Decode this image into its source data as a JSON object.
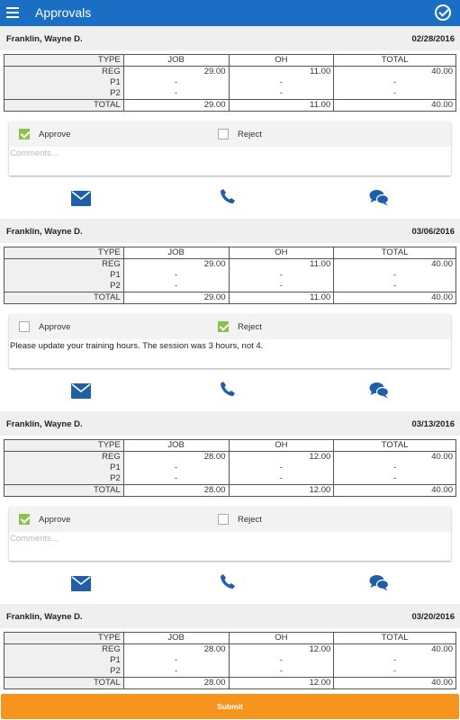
{
  "app": {
    "title": "Approvals"
  },
  "columns": {
    "type": "TYPE",
    "job": "JOB",
    "oh": "OH",
    "total": "TOTAL"
  },
  "rows": {
    "reg": "REG",
    "p1": "P1",
    "p2": "P2",
    "total": "TOTAL"
  },
  "options": {
    "approve": "Approve",
    "reject": "Reject",
    "comments_placeholder": "Comments..."
  },
  "entries": [
    {
      "employee": "Franklin, Wayne D.",
      "date": "02/28/2016",
      "reg": {
        "job": "29.00",
        "oh": "11.00",
        "total": "40.00"
      },
      "p1": {
        "job": "-",
        "oh": "-",
        "total": "-"
      },
      "p2": {
        "job": "-",
        "oh": "-",
        "total": "-"
      },
      "totals": {
        "job": "29.00",
        "oh": "11.00",
        "total": "40.00"
      },
      "approve": true,
      "reject": false,
      "comment": ""
    },
    {
      "employee": "Franklin, Wayne D.",
      "date": "03/06/2016",
      "reg": {
        "job": "29.00",
        "oh": "11.00",
        "total": "40.00"
      },
      "p1": {
        "job": "-",
        "oh": "-",
        "total": "-"
      },
      "p2": {
        "job": "-",
        "oh": "-",
        "total": "-"
      },
      "totals": {
        "job": "29.00",
        "oh": "11.00",
        "total": "40.00"
      },
      "approve": false,
      "reject": true,
      "comment": "Please update your training hours. The session was 3 hours, not 4."
    },
    {
      "employee": "Franklin, Wayne D.",
      "date": "03/13/2016",
      "reg": {
        "job": "28.00",
        "oh": "12.00",
        "total": "40.00"
      },
      "p1": {
        "job": "-",
        "oh": "-",
        "total": "-"
      },
      "p2": {
        "job": "-",
        "oh": "-",
        "total": "-"
      },
      "totals": {
        "job": "28.00",
        "oh": "12.00",
        "total": "40.00"
      },
      "approve": true,
      "reject": false,
      "comment": ""
    },
    {
      "employee": "Franklin, Wayne D.",
      "date": "03/20/2016",
      "reg": {
        "job": "28.00",
        "oh": "12.00",
        "total": "40.00"
      },
      "p1": {
        "job": "-",
        "oh": "-",
        "total": "-"
      },
      "p2": {
        "job": "-",
        "oh": "-",
        "total": "-"
      },
      "totals": {
        "job": "28.00",
        "oh": "12.00",
        "total": "40.00"
      },
      "approve": false,
      "reject": false,
      "comment": ""
    }
  ],
  "submit": {
    "label": "Submit"
  },
  "colors": {
    "topbar": "#1a6fc4",
    "accent_blue": "#1e5fa8",
    "check_green": "#8bc34a",
    "submit_orange": "#f7941d"
  },
  "icons": {
    "menu": "hamburger-icon",
    "done": "check-circle-icon",
    "mail": "mail-icon",
    "phone": "phone-icon",
    "chat": "chat-icon"
  }
}
